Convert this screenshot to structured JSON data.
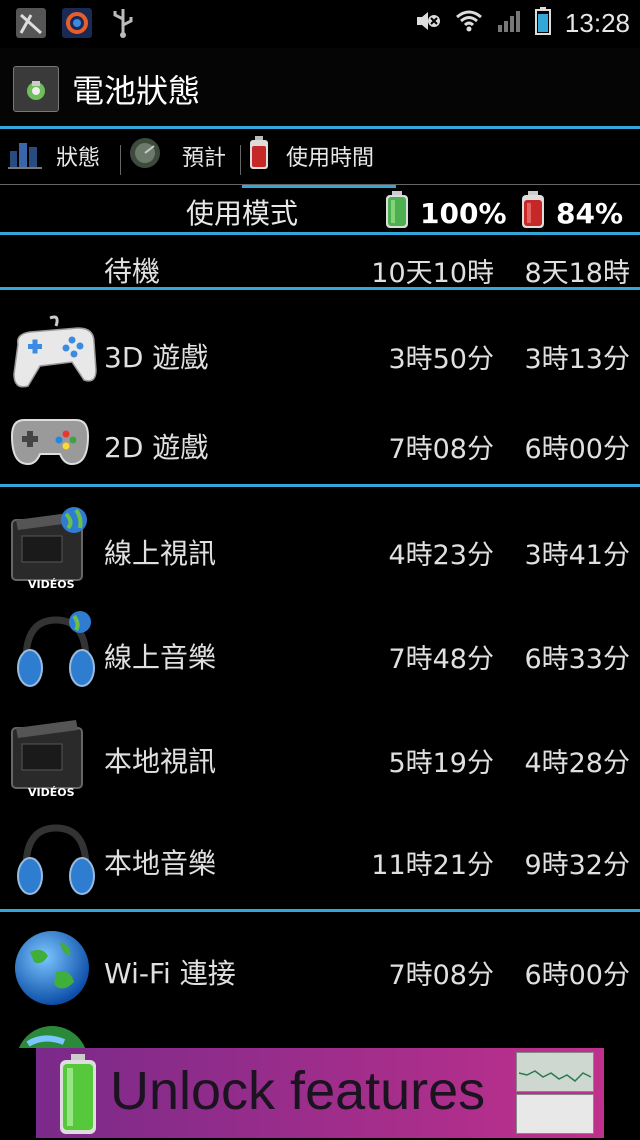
{
  "status_bar": {
    "time": "13:28",
    "left_icons": [
      "notification-icon",
      "app-icon",
      "usb-icon"
    ],
    "right_icons": [
      "mute-icon",
      "wifi-icon",
      "signal-icon",
      "battery-icon"
    ]
  },
  "title_bar": {
    "title": "電池狀態",
    "icon": "battery-app-icon"
  },
  "tabs": [
    {
      "label": "狀態",
      "icon": "status-icon",
      "active": false
    },
    {
      "label": "預計",
      "icon": "estimate-icon",
      "active": false
    },
    {
      "label": "使用時間",
      "icon": "battery-red-icon",
      "active": true
    }
  ],
  "header": {
    "label": "使用模式",
    "battery_full": "100%",
    "battery_current": "84%"
  },
  "rows": [
    {
      "label": "待機",
      "full": "10天10時",
      "current": "8天18時",
      "icon": ""
    },
    {
      "label": "3D 遊戲",
      "full": "3時50分",
      "current": "3時13分",
      "icon": "gamepad-3d-icon"
    },
    {
      "label": "2D 遊戲",
      "full": "7時08分",
      "current": "6時00分",
      "icon": "gamepad-2d-icon"
    },
    {
      "label": "線上視訊",
      "full": "4時23分",
      "current": "3時41分",
      "icon": "online-video-icon"
    },
    {
      "label": "線上音樂",
      "full": "7時48分",
      "current": "6時33分",
      "icon": "online-music-icon"
    },
    {
      "label": "本地視訊",
      "full": "5時19分",
      "current": "4時28分",
      "icon": "local-video-icon"
    },
    {
      "label": "本地音樂",
      "full": "11時21分",
      "current": "9時32分",
      "icon": "local-music-icon"
    },
    {
      "label": "Wi-Fi 連接",
      "full": "7時08分",
      "current": "6時00分",
      "icon": "wifi-globe-icon"
    }
  ],
  "video_icon_text": "VIDÉOS",
  "ad": {
    "text": "Unlock features"
  },
  "colors": {
    "accent": "#33a8d8",
    "background": "#000000",
    "battery_green": "#4caf50",
    "battery_red": "#c62828"
  }
}
